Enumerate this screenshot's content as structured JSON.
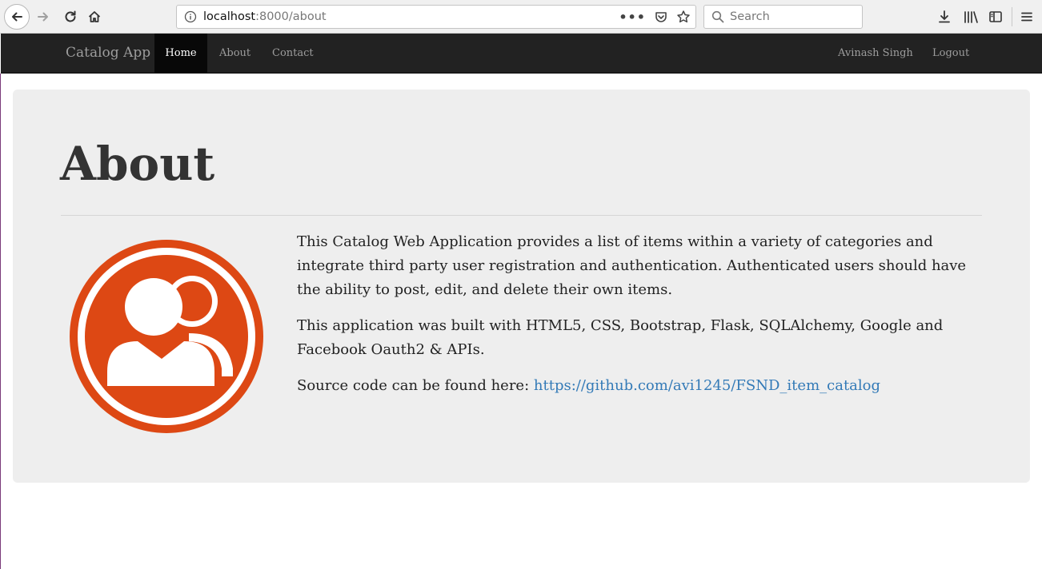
{
  "browser": {
    "url_host": "localhost",
    "url_rest": ":8000/about",
    "search_placeholder": "Search",
    "url_dots": "•••"
  },
  "navbar": {
    "brand": "Catalog App",
    "links": [
      "Home",
      "About",
      "Contact"
    ],
    "active_link": "Home",
    "user_name": "Avinash Singh",
    "logout": "Logout"
  },
  "main": {
    "title": "About",
    "paragraph1": "This Catalog Web Application provides a list of items within a variety of categories and integrate third party user registration and authentication. Authenticated users should have the ability to post, edit, and delete their own items.",
    "paragraph2": "This application was built with HTML5, CSS, Bootstrap, Flask, SQLAlchemy, Google and Facebook Oauth2 & APIs.",
    "source_label": "Source code can be found here:",
    "source_link": "https://github.com/avi1245/FSND_item_catalog"
  },
  "colors": {
    "logo_orange": "#dd4814",
    "navbar_bg": "#222222",
    "jumbotron_bg": "#eeeeee",
    "link": "#337ab7"
  }
}
